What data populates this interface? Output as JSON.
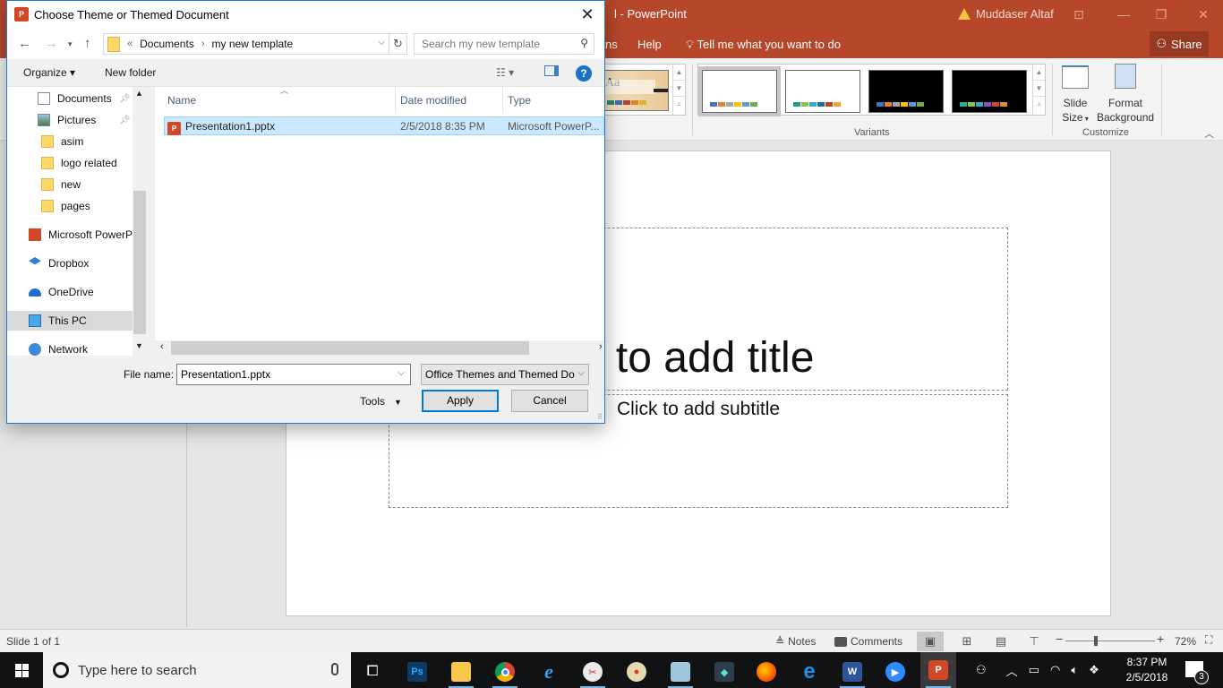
{
  "powerpoint": {
    "title": "l  -  PowerPoint",
    "user": "Muddaser Altaf",
    "menu": {
      "partial_tab": "ns",
      "help": "Help",
      "tell_me": "Tell me what you want to do",
      "share": "Share"
    },
    "ribbon": {
      "themes_partial_label": "Aa",
      "variants_label": "Variants",
      "customize_label": "Customize",
      "slide_size_label_1": "Slide",
      "slide_size_label_2": "Size",
      "format_bg_label_1": "Format",
      "format_bg_label_2": "Background",
      "variants": [
        {
          "bg": "#ffffff",
          "swatches": [
            "#4472c4",
            "#ed7d31",
            "#a5a5a5",
            "#ffc000",
            "#5b9bd5",
            "#70ad47"
          ]
        },
        {
          "bg": "#ffffff",
          "swatches": [
            "#1e9b7a",
            "#8dc14a",
            "#3aa9c7",
            "#1f6fa8",
            "#b7472a",
            "#f0a22e"
          ]
        },
        {
          "bg": "#000000",
          "swatches": [
            "#4472c4",
            "#ed7d31",
            "#a5a5a5",
            "#ffc000",
            "#5b9bd5",
            "#70ad47"
          ]
        },
        {
          "bg": "#000000",
          "swatches": [
            "#2bae93",
            "#8dc14a",
            "#3aa9c7",
            "#7e57c2",
            "#d04a2a",
            "#d9902c"
          ]
        }
      ],
      "theme_partial_swatches": [
        "#2e8b6e",
        "#3f6fb0",
        "#b0403a",
        "#e0802a",
        "#e0b030"
      ]
    },
    "slide": {
      "title_placeholder": "k to add title",
      "subtitle_placeholder": "Click to add subtitle"
    },
    "status": {
      "slide_counter": "Slide 1 of 1",
      "notes": "Notes",
      "comments": "Comments",
      "zoom": "72%",
      "zoom_value": 72
    }
  },
  "dialog": {
    "title": "Choose Theme or Themed Document",
    "breadcrumb": {
      "overflow": "«",
      "items": [
        "Documents",
        "my new template"
      ]
    },
    "search_placeholder": "Search my new template",
    "toolbar": {
      "organize": "Organize ▾",
      "new_folder": "New folder"
    },
    "nav_items": [
      {
        "label": "Documents",
        "icon": "documents-icon",
        "pinned": true
      },
      {
        "label": "Pictures",
        "icon": "pictures-icon",
        "pinned": true
      },
      {
        "label": "asim",
        "icon": "folder-icon"
      },
      {
        "label": "logo related",
        "icon": "folder-icon"
      },
      {
        "label": "new",
        "icon": "folder-icon"
      },
      {
        "label": "pages",
        "icon": "folder-icon"
      },
      {
        "label": "Microsoft PowerP",
        "icon": "powerpoint-icon"
      },
      {
        "label": "Dropbox",
        "icon": "dropbox-icon"
      },
      {
        "label": "OneDrive",
        "icon": "onedrive-icon"
      },
      {
        "label": "This PC",
        "icon": "this-pc-icon",
        "selected": true
      },
      {
        "label": "Network",
        "icon": "network-icon"
      }
    ],
    "columns": [
      "Name",
      "Date modified",
      "Type"
    ],
    "files": [
      {
        "name": "Presentation1.pptx",
        "date": "2/5/2018 8:35 PM",
        "type": "Microsoft PowerP..."
      }
    ],
    "file_name_label": "File name:",
    "file_name_value": "Presentation1.pptx",
    "file_type": "Office Themes and Themed Do",
    "tools": "Tools",
    "apply": "Apply",
    "cancel": "Cancel"
  },
  "taskbar": {
    "search_placeholder": "Type here to search",
    "apps": [
      "Photoshop",
      "File Explorer",
      "Chrome",
      "Internet Explorer",
      "Paint",
      "Paint 3D",
      "Notepad",
      "Filmora",
      "Firefox",
      "Edge",
      "Word",
      "Zoom",
      "PowerPoint"
    ],
    "time": "8:37 PM",
    "date": "2/5/2018",
    "notifications": "3"
  }
}
